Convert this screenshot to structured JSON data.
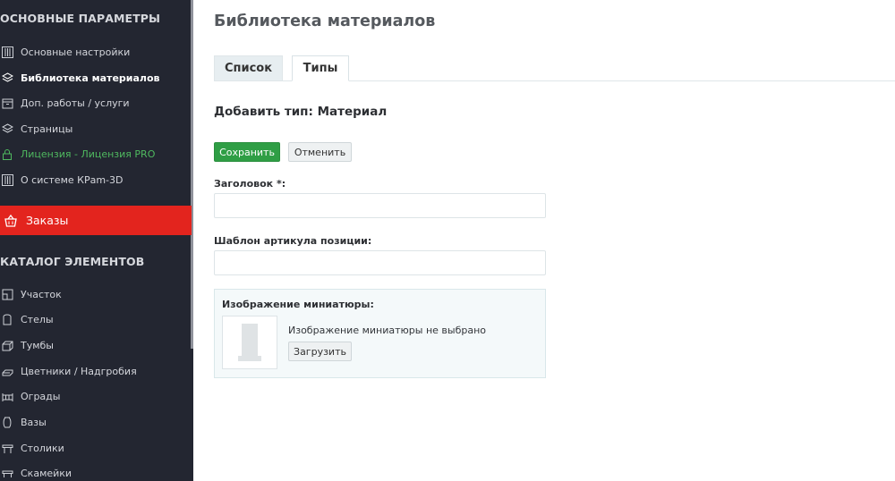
{
  "sidebar": {
    "section1_title": "ОСНОВНЫЕ ПАРАМЕТРЫ",
    "items1": [
      {
        "label": "Основные настройки",
        "icon": "sliders-icon"
      },
      {
        "label": "Библиотека материалов",
        "icon": "layers-icon"
      },
      {
        "label": "Доп. работы / услуги",
        "icon": "box-icon"
      },
      {
        "label": "Страницы",
        "icon": "layers-icon"
      },
      {
        "label": "Лицензия - Лицензия PRO",
        "icon": "lock-icon"
      },
      {
        "label": "О системе КРam-3D",
        "icon": "sliders-icon"
      }
    ],
    "orders_label": "Заказы",
    "section2_title": "КАТАЛОГ ЭЛЕМЕНТОВ",
    "items2": [
      {
        "label": "Участок",
        "icon": "plot-icon"
      },
      {
        "label": "Стелы",
        "icon": "stele-icon"
      },
      {
        "label": "Тумбы",
        "icon": "pedestal-icon"
      },
      {
        "label": "Цветники / Надгробия",
        "icon": "flowerbed-icon"
      },
      {
        "label": "Ограды",
        "icon": "fence-icon"
      },
      {
        "label": "Вазы",
        "icon": "vase-icon"
      },
      {
        "label": "Столики",
        "icon": "table-icon"
      },
      {
        "label": "Скамейки",
        "icon": "bench-icon"
      }
    ],
    "colors": {
      "background": "#232631",
      "active_red": "#e3241e",
      "license_green": "#4fb95f"
    }
  },
  "main": {
    "page_title": "Библиотека материалов",
    "tabs": [
      {
        "label": "Список"
      },
      {
        "label": "Типы"
      }
    ],
    "active_tab": "Типы",
    "form_title": "Добавить тип: Материал",
    "save_label": "Сохранить",
    "cancel_label": "Отменить",
    "title_label": "Заголовок *:",
    "title_value": "",
    "article_label": "Шаблон артикула позиции:",
    "article_value": "",
    "thumbnail": {
      "title": "Изображение миниатюры:",
      "status": "Изображение миниатюры не выбрано",
      "upload_label": "Загрузить"
    },
    "colors": {
      "save_green": "#2f9e45"
    }
  }
}
